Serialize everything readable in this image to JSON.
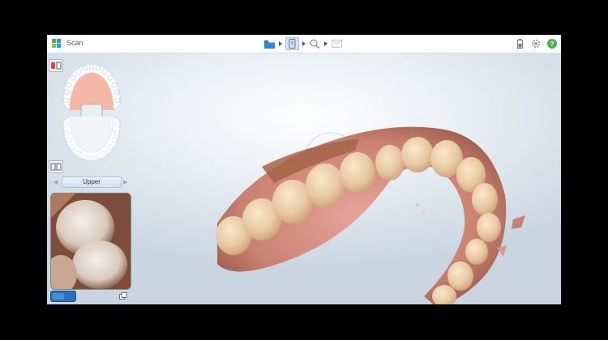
{
  "app": {
    "title": "Scan"
  },
  "toolbar": {
    "steps": [
      {
        "icon": "folder-icon",
        "state": "done"
      },
      {
        "icon": "scan-tooth-icon",
        "state": "active"
      },
      {
        "icon": "zoom-review-icon",
        "state": "pending"
      },
      {
        "icon": "send-icon",
        "state": "pending"
      }
    ],
    "right_icons": [
      "battery-icon",
      "gear-icon",
      "help-icon"
    ]
  },
  "left_panel": {
    "arch_label": "Upper"
  },
  "colors": {
    "accent_blue": "#2a6fb8",
    "help_green": "#4caf50",
    "step_active": "#cfe3f3"
  }
}
